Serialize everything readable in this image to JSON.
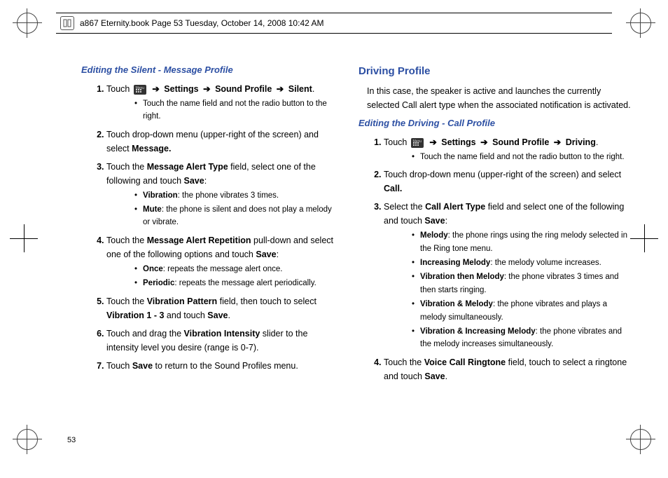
{
  "header": "a867 Eternity.book  Page 53  Tuesday, October 14, 2008  10:42 AM",
  "page_number": "53",
  "arrow": "➔",
  "left": {
    "h1": "Editing the Silent - Message Profile",
    "step1": {
      "touch": "Touch",
      "path": [
        "Settings",
        "Sound Profile",
        "Silent"
      ],
      "note": "Touch the name field and not the radio button to the right."
    },
    "step2": {
      "text_a": "Touch drop-down menu (upper-right of the screen) and select ",
      "bold": "Message."
    },
    "step3": {
      "text_a": "Touch the ",
      "bold_a": "Message Alert Type",
      "text_b": " field, select one of the following and touch ",
      "bold_b": "Save",
      "options": [
        {
          "name": "Vibration",
          "desc": ": the phone vibrates 3 times."
        },
        {
          "name": "Mute",
          "desc": ": the phone is silent and does not play a melody or vibrate."
        }
      ]
    },
    "step4": {
      "text_a": "Touch the ",
      "bold_a": "Message Alert Repetition",
      "text_b": " pull-down and select one of the following options and touch ",
      "bold_b": "Save",
      "options": [
        {
          "name": "Once",
          "desc": ": repeats the message alert once."
        },
        {
          "name": "Periodic",
          "desc": ": repeats the message alert periodically."
        }
      ]
    },
    "step5": {
      "text_a": "Touch the ",
      "bold_a": "Vibration Pattern",
      "text_b": " field, then touch to select ",
      "bold_b": "Vibration 1 - 3",
      "text_c": " and touch ",
      "bold_c": "Save"
    },
    "step6": {
      "text_a": "Touch and drag the ",
      "bold_a": "Vibration Intensity",
      "text_b": " slider to the intensity level you desire (range is 0-7)."
    },
    "step7": {
      "text_a": "Touch ",
      "bold_a": "Save",
      "text_b": " to return to the Sound Profiles menu."
    }
  },
  "right": {
    "h1": "Driving Profile",
    "intro": "In this case, the speaker is active and launches the currently selected Call alert type when the associated notification is activated.",
    "h2": "Editing the Driving - Call Profile",
    "step1": {
      "touch": "Touch",
      "path": [
        "Settings",
        "Sound Profile",
        "Driving"
      ],
      "note": "Touch the name field and not the radio button to the right."
    },
    "step2": {
      "text_a": "Touch drop-down menu (upper-right of the screen) and select ",
      "bold": "Call."
    },
    "step3": {
      "text_a": "Select the ",
      "bold_a": "Call Alert Type",
      "text_b": " field and select one of the following and touch ",
      "bold_b": "Save",
      "options": [
        {
          "name": "Melody",
          "desc": ": the phone rings using the ring melody selected in the Ring tone menu."
        },
        {
          "name": "Increasing Melody",
          "desc": ": the melody volume increases."
        },
        {
          "name": "Vibration then Melody",
          "desc": ": the phone vibrates 3 times and then starts ringing."
        },
        {
          "name": "Vibration & Melody",
          "desc": ": the phone vibrates and plays a melody simultaneously."
        },
        {
          "name": "Vibration & Increasing Melody",
          "desc": ": the phone vibrates and the melody increases simultaneously."
        }
      ]
    },
    "step4": {
      "text_a": "Touch the ",
      "bold_a": "Voice Call Ringtone",
      "text_b": " field, touch to select a ringtone and touch ",
      "bold_b": "Save"
    }
  }
}
